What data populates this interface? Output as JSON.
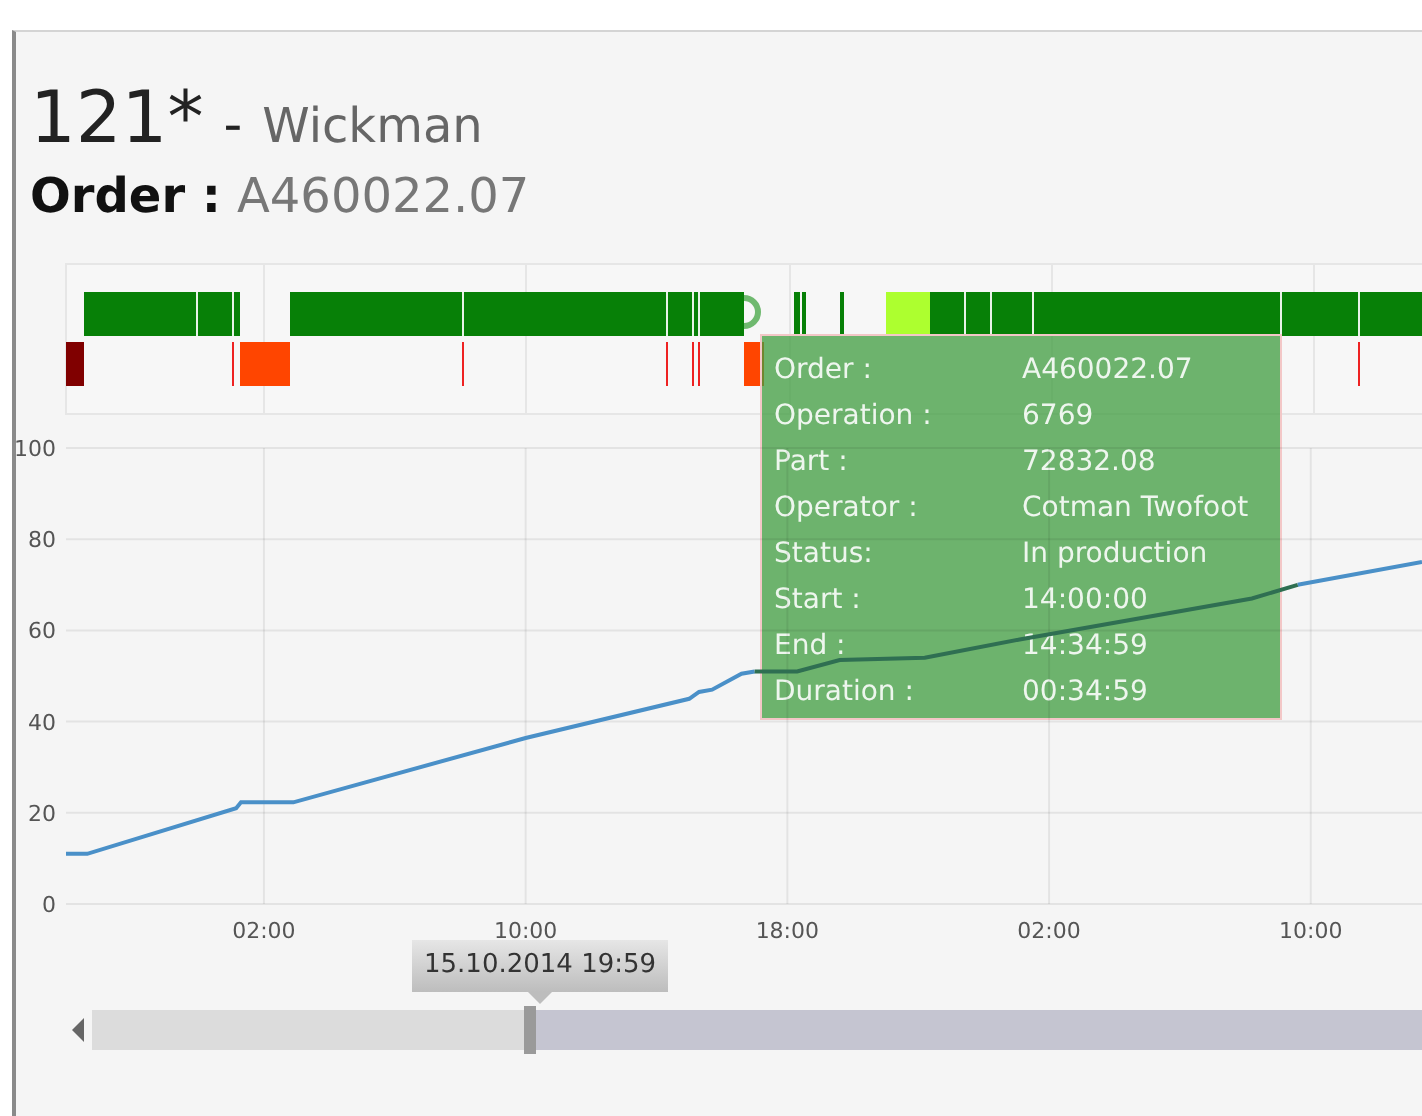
{
  "header": {
    "machine": "121*",
    "separator": "-",
    "machine_name": "Wickman",
    "order_label": "Order :",
    "order_value": "A460022.07"
  },
  "chart": {
    "chart_data": {
      "type": "line",
      "grid": true,
      "x": [
        "2014-10-14 19:57",
        "2014-10-14 20:36",
        "2014-10-15 01:09",
        "2014-10-15 01:18",
        "2014-10-15 02:54",
        "2014-10-15 10:00",
        "2014-10-15 15:00",
        "2014-10-15 15:18",
        "2014-10-15 15:42",
        "2014-10-15 16:36",
        "2014-10-15 17:00",
        "2014-10-15 18:18",
        "2014-10-15 19:36",
        "2014-10-15 22:12",
        "2014-10-16 01:06",
        "2014-10-16 08:12",
        "2014-10-16 09:36",
        "2014-10-16 13:24"
      ],
      "series": [
        {
          "color": "#4a90c8",
          "values": [
            11,
            11,
            21,
            22.3,
            22.3,
            36.4,
            45,
            46.5,
            47,
            50.5,
            51,
            null,
            null,
            null,
            null,
            null,
            70,
            75
          ]
        },
        {
          "color": "#2f6f52",
          "values": [
            null,
            null,
            null,
            null,
            null,
            null,
            null,
            null,
            null,
            null,
            51,
            51,
            53.5,
            54,
            58,
            67,
            70,
            null
          ]
        }
      ],
      "xlim": [
        "2014-10-14 19:57",
        "2014-10-16 13:24"
      ],
      "ylim": [
        0,
        100
      ],
      "xticks": [
        {
          "value": "2014-10-15 02:00",
          "label": "02:00"
        },
        {
          "value": "2014-10-15 10:00",
          "label": "10:00"
        },
        {
          "value": "2014-10-15 18:00",
          "label": "18:00"
        },
        {
          "value": "2014-10-16 02:00",
          "label": "02:00"
        },
        {
          "value": "2014-10-16 10:00",
          "label": "10:00"
        }
      ],
      "yticks": [
        0,
        20,
        40,
        60,
        80,
        100
      ]
    }
  },
  "tooltip": {
    "rows": [
      {
        "label": "Order :",
        "value": "A460022.07"
      },
      {
        "label": "Operation :",
        "value": "6769"
      },
      {
        "label": "Part :",
        "value": "72832.08"
      },
      {
        "label": "Operator :",
        "value": "Cotman Twofoot"
      },
      {
        "label": "Status:",
        "value": "In production"
      },
      {
        "label": "Start :",
        "value": "14:00:00"
      },
      {
        "label": "End :",
        "value": "14:34:59"
      },
      {
        "label": "Duration :",
        "value": "00:34:59"
      }
    ]
  },
  "navigator": {
    "date_label": "15.10.2014 19:59",
    "level": 0.33
  }
}
